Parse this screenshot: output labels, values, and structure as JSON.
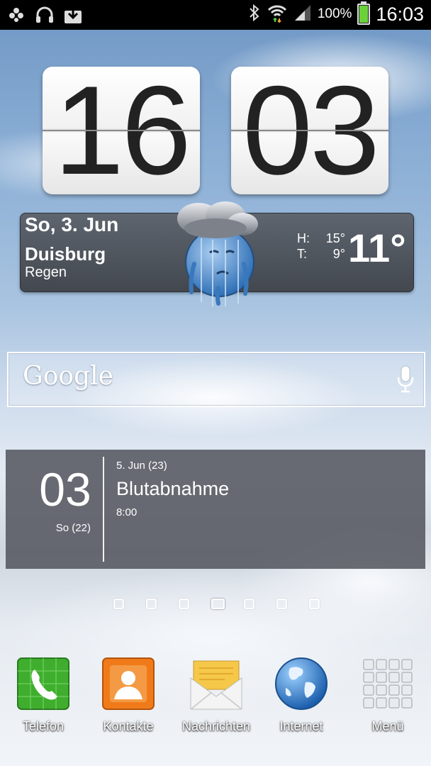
{
  "status_bar": {
    "battery_percent": "100%",
    "time": "16:03",
    "battery_level": 1.0,
    "icons": [
      "apps-icon",
      "headset-icon",
      "download-icon",
      "bluetooth-icon",
      "wifi-icon",
      "signal-icon",
      "battery-icon"
    ]
  },
  "clock": {
    "hours": "16",
    "minutes": "03"
  },
  "weather": {
    "date": "So, 3. Jun",
    "city": "Duisburg",
    "condition": "Regen",
    "high_label": "H:",
    "high_value": "15°",
    "low_label": "T:",
    "low_value": "9°",
    "current_temp": "11°",
    "icon": "rain-cloud-icon"
  },
  "search": {
    "logo": "Google",
    "icon": "microphone-icon"
  },
  "calendar": {
    "day": "03",
    "week": "So (22)",
    "event_date": "5. Jun (23)",
    "event_title": "Blutabnahme",
    "event_time": "8:00"
  },
  "page_indicator": {
    "count": 7,
    "active_index": 3
  },
  "dock": {
    "phone": "Telefon",
    "contacts": "Kontakte",
    "messages": "Nachrichten",
    "internet": "Internet",
    "menu": "Menü"
  },
  "colors": {
    "phone": "#3fae2e",
    "contacts": "#f07a1a",
    "messages": "#f5c84a",
    "internet": "#2a7ac8",
    "battery": "#6ad13a"
  }
}
